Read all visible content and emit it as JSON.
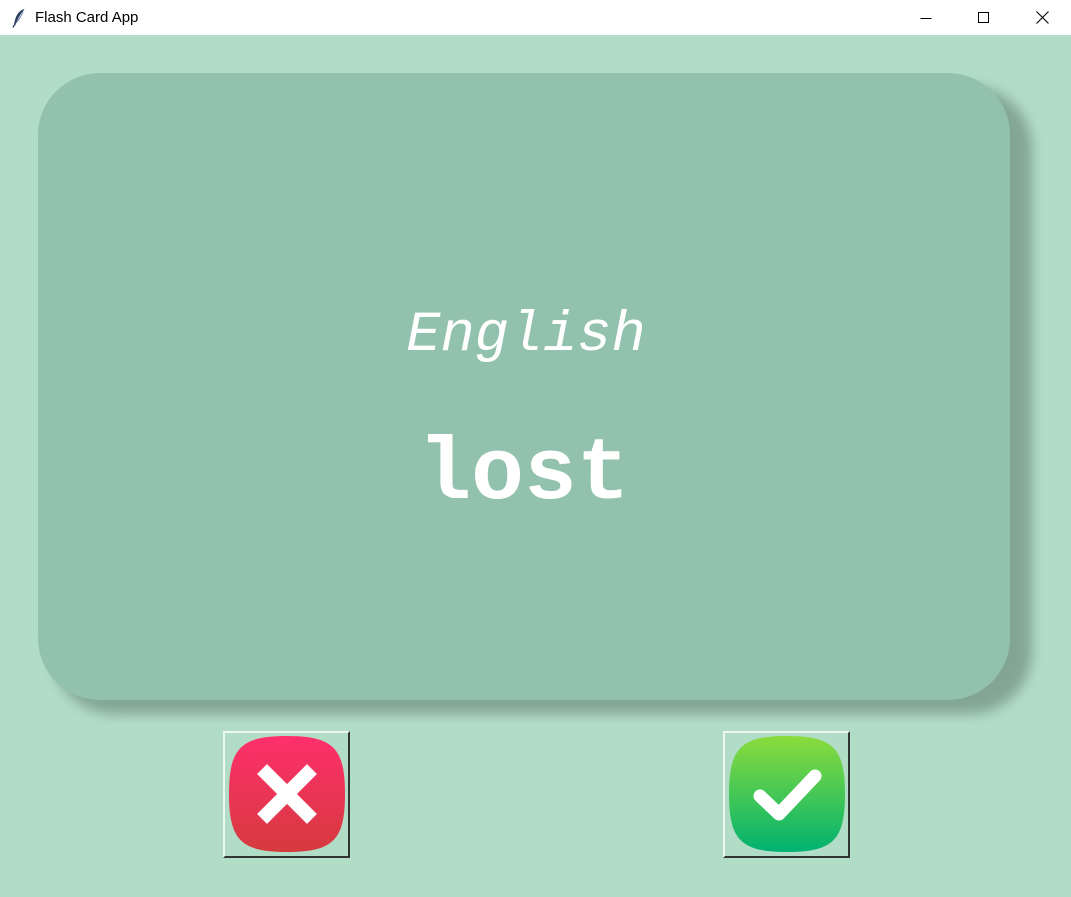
{
  "window": {
    "title": "Flash Card App",
    "icon": "feather-icon",
    "controls": [
      "minimize-icon",
      "maximize-icon",
      "close-icon"
    ]
  },
  "card": {
    "language": "English",
    "word": "lost"
  },
  "buttons": {
    "wrong_icon": "x-icon",
    "right_icon": "check-icon"
  },
  "colors": {
    "background": "#b1dcc6",
    "card": "#92c1ae",
    "card_text": "#ffffff",
    "wrong_button": "#e8355a",
    "right_button": "#1fc160"
  }
}
